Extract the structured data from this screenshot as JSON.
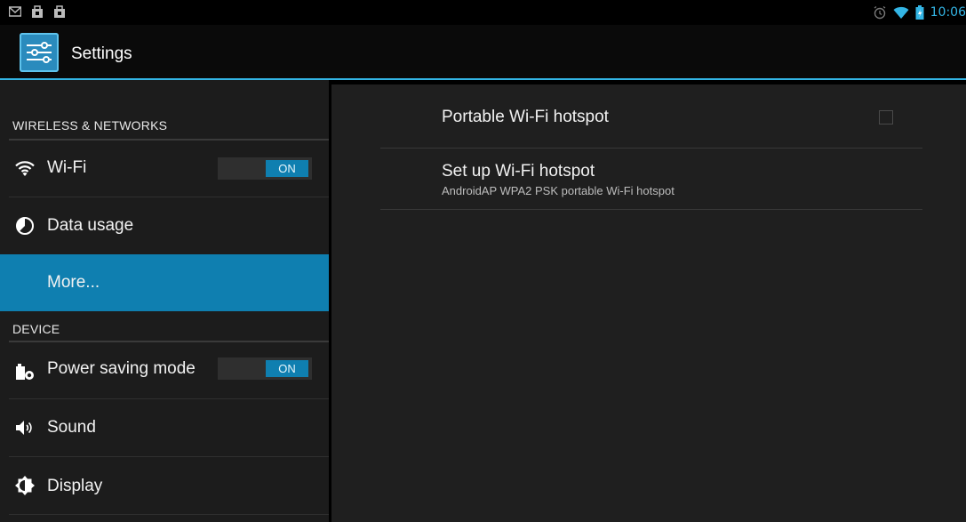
{
  "status_bar": {
    "left_icons": [
      "gmail-icon",
      "shopping-bag-icon",
      "shopping-bag-icon"
    ],
    "right_icons": [
      "alarm-icon",
      "wifi-icon",
      "battery-icon"
    ],
    "time": "10:06"
  },
  "action_bar": {
    "app_icon": "settings-sliders-icon",
    "title": "Settings"
  },
  "sidebar": {
    "sections": [
      {
        "header": "WIRELESS & NETWORKS",
        "items": [
          {
            "label": "Wi-Fi",
            "icon": "wifi-icon",
            "toggle": "ON"
          },
          {
            "label": "Data usage",
            "icon": "data-usage-icon"
          },
          {
            "label": "More...",
            "selected": true
          }
        ]
      },
      {
        "header": "DEVICE",
        "items": [
          {
            "label": "Power saving mode",
            "icon": "power-saving-icon",
            "toggle": "ON"
          },
          {
            "label": "Sound",
            "icon": "sound-icon"
          },
          {
            "label": "Display",
            "icon": "display-icon"
          }
        ]
      }
    ]
  },
  "detail": {
    "items": [
      {
        "title": "Portable Wi-Fi hotspot",
        "checked": false
      },
      {
        "title": "Set up Wi-Fi hotspot",
        "summary": "AndroidAP WPA2 PSK portable Wi-Fi hotspot"
      }
    ]
  },
  "colors": {
    "accent": "#33b5e5",
    "selected": "#0f7fb0"
  }
}
